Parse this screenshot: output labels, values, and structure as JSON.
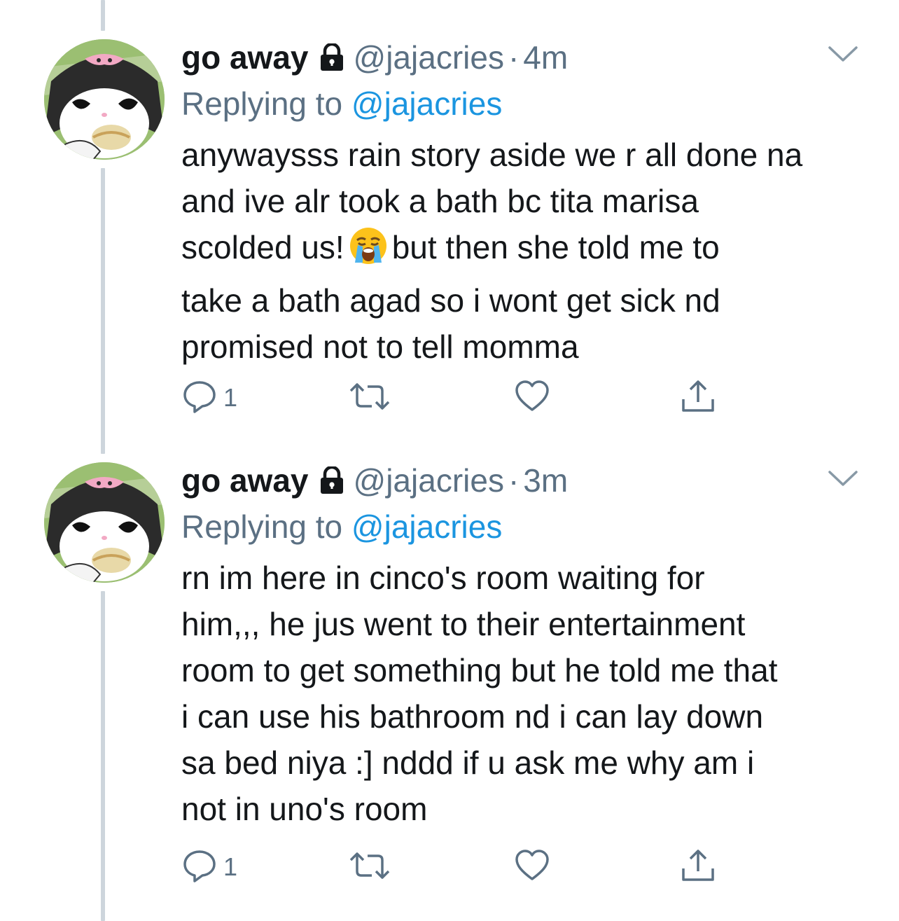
{
  "tweets": [
    {
      "name": "go away",
      "handle": "@jajacries",
      "separator": "·",
      "time": "4m",
      "replying_prefix": "Replying to",
      "replying_to": "@jajacries",
      "text_lines": [
        "anywaysss rain story aside we r all done na",
        "and ive alr took a bath bc tita marisa",
        "scolded us!",
        "but then she told me to",
        "take a bath agad so i wont get sick nd",
        "promised not to tell momma"
      ],
      "reply_count": "1"
    },
    {
      "name": "go away",
      "handle": "@jajacries",
      "separator": "·",
      "time": "3m",
      "replying_prefix": "Replying to",
      "replying_to": "@jajacries",
      "text_lines": [
        "rn im here in cinco's room waiting for",
        "him,,, he jus went to their entertainment",
        "room to get something but he told me that",
        "i can use his bathroom nd i can lay down",
        "sa bed niya :] nddd if u ask me why am i",
        "not in uno's room"
      ],
      "reply_count": "1"
    }
  ],
  "icons": {
    "lock": "lock-icon",
    "emoji": "loudly-crying-face-emoji",
    "more": "chevron-down-icon",
    "reply": "reply-icon",
    "retweet": "retweet-icon",
    "like": "heart-icon",
    "share": "share-icon"
  },
  "colors": {
    "text": "#14171a",
    "secondary": "#5b7083",
    "link": "#1b95e0",
    "thread_line": "#cdd5dc"
  }
}
